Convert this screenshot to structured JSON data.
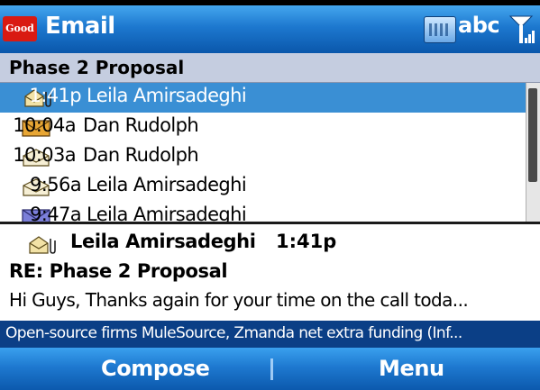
{
  "status_bar": {
    "logo_text": "Good",
    "app_title": "Email",
    "input_mode": "abc",
    "icons": [
      "keyboard-icon",
      "signal-strength-icon"
    ]
  },
  "folder": {
    "title": "Phase 2 Proposal"
  },
  "messages": [
    {
      "time": "1:41p",
      "sender": "Leila Amirsadeghi",
      "icon": "read-with-attachment-icon",
      "selected": true
    },
    {
      "time": "10:04a",
      "sender": "Dan Rudolph",
      "icon": "unread-envelope-icon",
      "selected": false
    },
    {
      "time": "10:03a",
      "sender": "Dan Rudolph",
      "icon": "read-envelope-icon",
      "selected": false
    },
    {
      "time": "9:56a",
      "sender": "Leila Amirsadeghi",
      "icon": "read-envelope-icon",
      "selected": false
    },
    {
      "time": "9:47a",
      "sender": "Leila Amirsadeghi",
      "icon": "read-envelope-icon",
      "selected": false
    }
  ],
  "preview": {
    "from": "Leila Amirsadeghi",
    "time": "1:41p",
    "subject": "RE: Phase 2 Proposal",
    "body": "Hi Guys,   Thanks again for your time on the call toda..."
  },
  "ticker": {
    "text": "Open-source firms MuleSource, Zmanda net extra funding (Inf..."
  },
  "softkeys": {
    "left": "Compose",
    "right": "Menu"
  },
  "colors": {
    "title_bar": "#1d78cf",
    "selection": "#3a8fd4",
    "header_bg": "#c5cde0",
    "ticker_bg": "#0b3f86",
    "logo_red": "#d91a12"
  }
}
